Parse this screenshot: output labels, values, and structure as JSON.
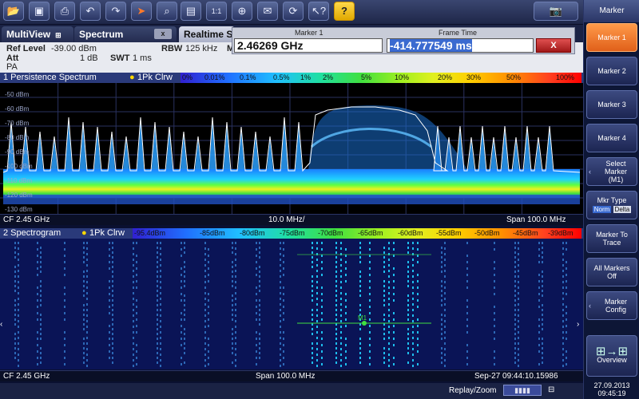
{
  "toolbar": {
    "icons": [
      "menu-icon",
      "open-folder-icon",
      "save-icon",
      "print-icon",
      "undo-icon",
      "redo-icon",
      "select-cursor-icon",
      "zoom-icon",
      "table-icon",
      "one-to-one-icon",
      "marker-zoom-icon",
      "email-icon",
      "sync-icon",
      "help-pointer-icon",
      "help-icon",
      "camera-icon"
    ]
  },
  "softkeys": {
    "title": "Marker",
    "items": [
      "Marker 1",
      "Marker 2",
      "Marker 3",
      "Marker 4",
      "Select Marker (M1)",
      "Mkr Type",
      "Marker To Trace",
      "All Markers Off",
      "Marker Config",
      "Overview"
    ],
    "mkr_type_norm": "Norm",
    "mkr_type_delta": "Delta"
  },
  "tabs": {
    "multiview": "MultiView",
    "spectrum": "Spectrum",
    "realtime": "Realtime S",
    "close": "x"
  },
  "info": {
    "ref_level_label": "Ref Level",
    "ref_level_value": "-39.00 dBm",
    "att_label": "Att",
    "att_value": "1 dB",
    "swt_label": "SWT",
    "swt_value": "1 ms",
    "rbw_label": "RBW",
    "rbw_value": "125 kHz",
    "m_label": "M",
    "pa": "PA"
  },
  "marker_popup": {
    "marker_label": "Marker 1",
    "marker_value": "2.46269 GHz",
    "frame_label": "Frame Time",
    "frame_value": "-414.777549 ms",
    "close": "X"
  },
  "persistence": {
    "title": "1 Persistence Spectrum",
    "trace": "1Pk Clrw",
    "scale": [
      "0%",
      "0.01%",
      "0.1%",
      "0.5%",
      "1%",
      "2%",
      "5%",
      "10%",
      "20%",
      "30%",
      "50%",
      "100%"
    ],
    "y_ticks": [
      "-50 dBm",
      "-60 dBm",
      "-70 dBm",
      "-80 dBm",
      "-90 dBm",
      "-100 dBm",
      "-110 dBm",
      "-120 dBm",
      "-130 dBm"
    ],
    "footer_cf": "CF 2.45 GHz",
    "footer_div": "10.0 MHz/",
    "footer_span": "Span 100.0 MHz"
  },
  "spectrogram": {
    "title": "2 Spectrogram",
    "trace": "1Pk Clrw",
    "scale": [
      "-95.4dBm",
      "-85dBm",
      "-80dBm",
      "-75dBm",
      "-70dBm",
      "-65dBm",
      "-60dBm",
      "-55dBm",
      "-50dBm",
      "-45dBm",
      "-39dBm"
    ],
    "marker": "M1",
    "footer_cf": "CF 2.45 GHz",
    "footer_span": "Span 100.0 MHz",
    "footer_time": "Sep-27 09:44:10.15986"
  },
  "status": {
    "mode": "Replay/Zoom",
    "date": "27.09.2013",
    "time": "09:45:19"
  }
}
